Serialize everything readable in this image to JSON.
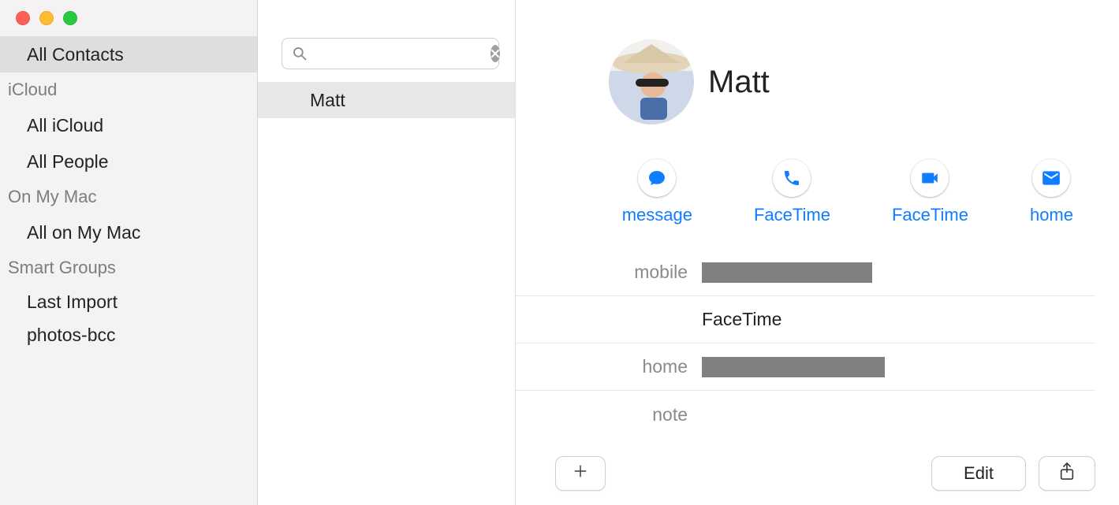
{
  "sidebar": {
    "all_contacts": "All Contacts",
    "sections": [
      {
        "title": "iCloud",
        "items": [
          "All iCloud",
          "All People"
        ]
      },
      {
        "title": "On My Mac",
        "items": [
          "All on My Mac"
        ]
      },
      {
        "title": "Smart Groups",
        "items": [
          "Last Import",
          "photos-bcc"
        ]
      }
    ]
  },
  "search": {
    "placeholder": "",
    "value": ""
  },
  "contact_list": {
    "items": [
      {
        "name": "Matt"
      }
    ],
    "selected_index": 0
  },
  "detail": {
    "name": "Matt",
    "actions": [
      {
        "id": "message",
        "label": "message"
      },
      {
        "id": "facetime-audio",
        "label": "FaceTime"
      },
      {
        "id": "facetime-video",
        "label": "FaceTime"
      },
      {
        "id": "home-email",
        "label": "home"
      }
    ],
    "fields": [
      {
        "label": "mobile",
        "value": "",
        "redacted": true,
        "redact_width": 216
      },
      {
        "label": "",
        "value": "FaceTime",
        "redacted": false
      },
      {
        "label": "home",
        "value": "",
        "redacted": true,
        "redact_width": 232
      },
      {
        "label": "note",
        "value": "",
        "redacted": false
      }
    ],
    "edit_label": "Edit"
  }
}
